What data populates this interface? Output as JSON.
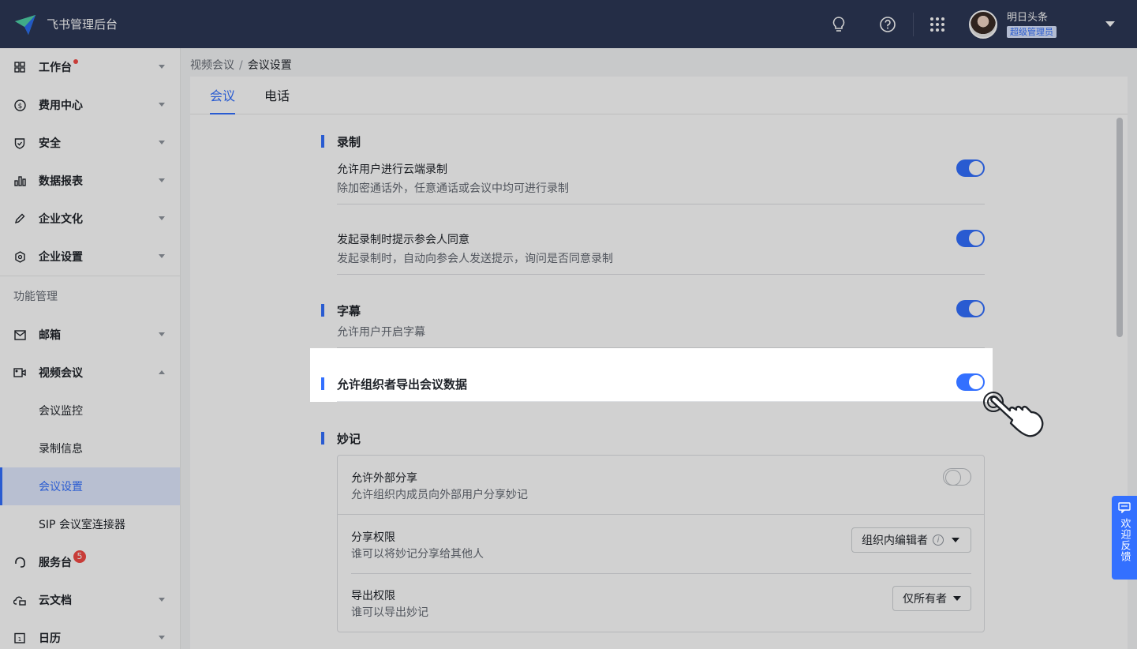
{
  "header": {
    "app_title": "飞书管理后台",
    "user_name": "明日头条",
    "user_role": "超级管理员"
  },
  "sidebar": {
    "items": [
      {
        "label": "工作台"
      },
      {
        "label": "费用中心"
      },
      {
        "label": "安全"
      },
      {
        "label": "数据报表"
      },
      {
        "label": "企业文化"
      },
      {
        "label": "企业设置"
      }
    ],
    "section_title": "功能管理",
    "func_items": [
      {
        "label": "邮箱"
      },
      {
        "label": "视频会议"
      }
    ],
    "sub_items": [
      "会议监控",
      "录制信息",
      "会议设置",
      "SIP 会议室连接器"
    ],
    "service_desk": {
      "label": "服务台",
      "badge": "5"
    },
    "bottom_items": [
      {
        "label": "云文档"
      },
      {
        "label": "日历"
      }
    ]
  },
  "breadcrumb": {
    "parent": "视频会议",
    "separator": "/",
    "current": "会议设置"
  },
  "tabs": [
    "会议",
    "电话"
  ],
  "settings": {
    "recording": {
      "header": "录制",
      "item1": {
        "title": "允许用户进行云端录制",
        "desc": "除加密通话外，任意通话或会议中均可进行录制",
        "enabled": true
      },
      "item2": {
        "title": "发起录制时提示参会人同意",
        "desc": "发起录制时，自动向参会人发送提示，询问是否同意录制",
        "enabled": true
      }
    },
    "captions": {
      "header": "字幕",
      "desc": "允许用户开启字幕",
      "enabled": true
    },
    "export": {
      "header": "允许组织者导出会议数据",
      "enabled": true
    },
    "minutes": {
      "header": "妙记",
      "external_share": {
        "title": "允许外部分享",
        "desc": "允许组织内成员向外部用户分享妙记",
        "enabled": false
      },
      "share_perm": {
        "title": "分享权限",
        "desc": "谁可以将妙记分享给其他人",
        "value": "组织内编辑者"
      },
      "export_perm": {
        "title": "导出权限",
        "desc": "谁可以导出妙记",
        "value": "仅所有者"
      }
    }
  },
  "feedback": {
    "label": "欢迎反馈"
  },
  "colors": {
    "accent": "#3370ff",
    "topbar": "#2d3756",
    "badge": "#f54a45"
  }
}
